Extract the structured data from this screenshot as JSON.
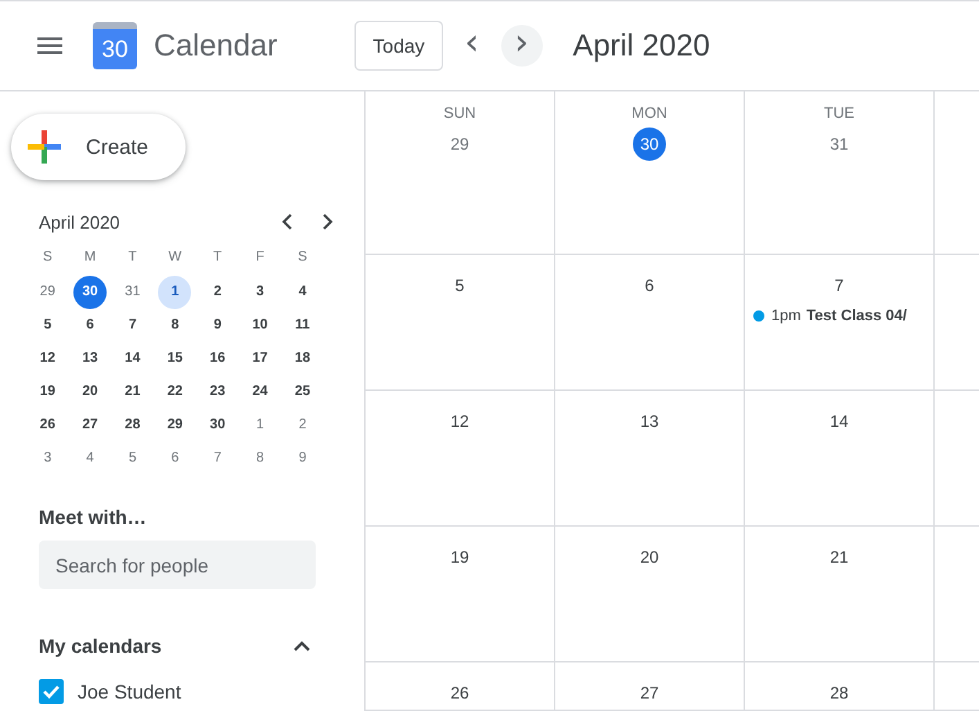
{
  "header": {
    "app_name": "Calendar",
    "logo_day": "30",
    "today_button": "Today",
    "prev": "‹",
    "next": "›",
    "title": "April 2020"
  },
  "sidebar": {
    "create_button": "Create",
    "mini_calendar": {
      "title": "April 2020",
      "weekdays": [
        "S",
        "M",
        "T",
        "W",
        "T",
        "F",
        "S"
      ],
      "days": [
        {
          "day": "29",
          "outside": true,
          "today": false,
          "selected": false
        },
        {
          "day": "30",
          "outside": true,
          "today": true,
          "selected": false
        },
        {
          "day": "31",
          "outside": true,
          "today": false,
          "selected": false
        },
        {
          "day": "1",
          "outside": false,
          "today": false,
          "selected": true
        },
        {
          "day": "2",
          "outside": false,
          "today": false,
          "selected": false
        },
        {
          "day": "3",
          "outside": false,
          "today": false,
          "selected": false
        },
        {
          "day": "4",
          "outside": false,
          "today": false,
          "selected": false
        },
        {
          "day": "5",
          "outside": false,
          "today": false,
          "selected": false
        },
        {
          "day": "6",
          "outside": false,
          "today": false,
          "selected": false
        },
        {
          "day": "7",
          "outside": false,
          "today": false,
          "selected": false
        },
        {
          "day": "8",
          "outside": false,
          "today": false,
          "selected": false
        },
        {
          "day": "9",
          "outside": false,
          "today": false,
          "selected": false
        },
        {
          "day": "10",
          "outside": false,
          "today": false,
          "selected": false
        },
        {
          "day": "11",
          "outside": false,
          "today": false,
          "selected": false
        },
        {
          "day": "12",
          "outside": false,
          "today": false,
          "selected": false
        },
        {
          "day": "13",
          "outside": false,
          "today": false,
          "selected": false
        },
        {
          "day": "14",
          "outside": false,
          "today": false,
          "selected": false
        },
        {
          "day": "15",
          "outside": false,
          "today": false,
          "selected": false
        },
        {
          "day": "16",
          "outside": false,
          "today": false,
          "selected": false
        },
        {
          "day": "17",
          "outside": false,
          "today": false,
          "selected": false
        },
        {
          "day": "18",
          "outside": false,
          "today": false,
          "selected": false
        },
        {
          "day": "19",
          "outside": false,
          "today": false,
          "selected": false
        },
        {
          "day": "20",
          "outside": false,
          "today": false,
          "selected": false
        },
        {
          "day": "21",
          "outside": false,
          "today": false,
          "selected": false
        },
        {
          "day": "22",
          "outside": false,
          "today": false,
          "selected": false
        },
        {
          "day": "23",
          "outside": false,
          "today": false,
          "selected": false
        },
        {
          "day": "24",
          "outside": false,
          "today": false,
          "selected": false
        },
        {
          "day": "25",
          "outside": false,
          "today": false,
          "selected": false
        },
        {
          "day": "26",
          "outside": false,
          "today": false,
          "selected": false
        },
        {
          "day": "27",
          "outside": false,
          "today": false,
          "selected": false
        },
        {
          "day": "28",
          "outside": false,
          "today": false,
          "selected": false
        },
        {
          "day": "29",
          "outside": false,
          "today": false,
          "selected": false
        },
        {
          "day": "30",
          "outside": false,
          "today": false,
          "selected": false
        },
        {
          "day": "1",
          "outside": true,
          "today": false,
          "selected": false
        },
        {
          "day": "2",
          "outside": true,
          "today": false,
          "selected": false
        },
        {
          "day": "3",
          "outside": true,
          "today": false,
          "selected": false
        },
        {
          "day": "4",
          "outside": true,
          "today": false,
          "selected": false
        },
        {
          "day": "5",
          "outside": true,
          "today": false,
          "selected": false
        },
        {
          "day": "6",
          "outside": true,
          "today": false,
          "selected": false
        },
        {
          "day": "7",
          "outside": true,
          "today": false,
          "selected": false
        },
        {
          "day": "8",
          "outside": true,
          "today": false,
          "selected": false
        },
        {
          "day": "9",
          "outside": true,
          "today": false,
          "selected": false
        }
      ]
    },
    "meet_with": {
      "title": "Meet with…",
      "placeholder": "Search for people"
    },
    "my_calendars": {
      "title": "My calendars",
      "expanded": true,
      "items": [
        {
          "label": "Joe Student",
          "checked": true,
          "color": "#039be5"
        }
      ]
    }
  },
  "month_grid": {
    "weekdays": [
      "SUN",
      "MON",
      "TUE"
    ],
    "cells": [
      {
        "day": "29",
        "outside": true,
        "today": false
      },
      {
        "day": "30",
        "outside": true,
        "today": true
      },
      {
        "day": "31",
        "outside": true,
        "today": false
      },
      {
        "day": "5",
        "outside": false,
        "today": false
      },
      {
        "day": "6",
        "outside": false,
        "today": false
      },
      {
        "day": "7",
        "outside": false,
        "today": false,
        "events": [
          {
            "time": "1pm",
            "title": "Test Class 04/",
            "color": "#039be5"
          }
        ]
      },
      {
        "day": "12",
        "outside": false,
        "today": false
      },
      {
        "day": "13",
        "outside": false,
        "today": false
      },
      {
        "day": "14",
        "outside": false,
        "today": false
      },
      {
        "day": "19",
        "outside": false,
        "today": false
      },
      {
        "day": "20",
        "outside": false,
        "today": false
      },
      {
        "day": "21",
        "outside": false,
        "today": false
      },
      {
        "day": "26",
        "outside": false,
        "today": false
      },
      {
        "day": "27",
        "outside": false,
        "today": false
      },
      {
        "day": "28",
        "outside": false,
        "today": false
      }
    ]
  }
}
